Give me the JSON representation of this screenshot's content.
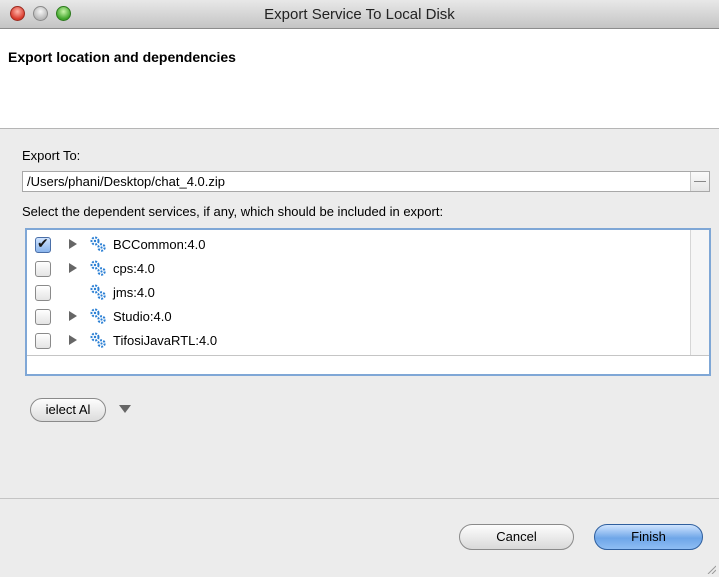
{
  "window": {
    "title": "Export Service To Local Disk"
  },
  "header": {
    "title": "Export location and dependencies"
  },
  "export_to": {
    "label": "Export To:",
    "value": "/Users/phani/Desktop/chat_4.0.zip"
  },
  "dependencies": {
    "label": "Select the dependent services, if any, which should be included in export:",
    "items": [
      {
        "label": "BCCommon:4.0",
        "checked": true,
        "expandable": true
      },
      {
        "label": "cps:4.0",
        "checked": false,
        "expandable": true
      },
      {
        "label": "jms:4.0",
        "checked": false,
        "expandable": false
      },
      {
        "label": "Studio:4.0",
        "checked": false,
        "expandable": true
      },
      {
        "label": "TifosiJavaRTL:4.0",
        "checked": false,
        "expandable": true
      }
    ]
  },
  "actions": {
    "select_all_label": "ielect Al",
    "cancel_label": "Cancel",
    "finish_label": "Finish"
  },
  "colors": {
    "focus_ring": "#7fa7d6",
    "default_button": "#6ea6e8",
    "icon": "#2a7fd4"
  }
}
